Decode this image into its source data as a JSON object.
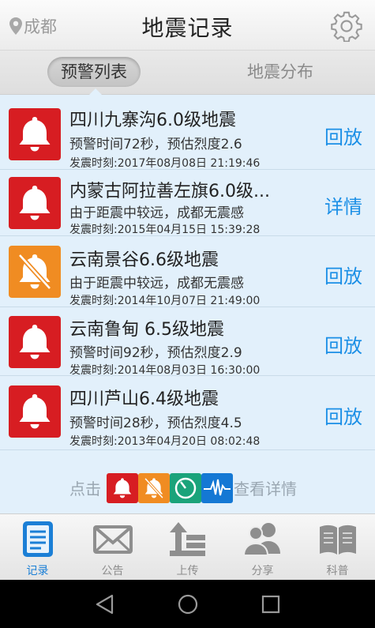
{
  "header": {
    "location": "成都",
    "title": "地震记录"
  },
  "tabs": [
    {
      "label": "预警列表"
    },
    {
      "label": "地震分布"
    }
  ],
  "list": [
    {
      "title": "四川九寨沟6.0级地震",
      "desc": "预警时间72秒，预估烈度2.6",
      "time": "发震时刻:2017年08月08日 21:19:46",
      "action": "回放",
      "level": "red",
      "icon": "bell-icon"
    },
    {
      "title": "内蒙古阿拉善左旗6.0级...",
      "desc": "由于距震中较远，成都无震感",
      "time": "发震时刻:2015年04月15日 15:39:28",
      "action": "详情",
      "level": "red",
      "icon": "bell-icon"
    },
    {
      "title": "云南景谷6.6级地震",
      "desc": "由于距震中较远，成都无震感",
      "time": "发震时刻:2014年10月07日 21:49:00",
      "action": "回放",
      "level": "orange",
      "icon": "bell-muted-icon"
    },
    {
      "title": "云南鲁甸 6.5级地震",
      "desc": "预警时间92秒，预估烈度2.9",
      "time": "发震时刻:2014年08月03日 16:30:00",
      "action": "回放",
      "level": "red",
      "icon": "bell-icon"
    },
    {
      "title": "四川芦山6.4级地震",
      "desc": "预警时间28秒，预估烈度4.5",
      "time": "发震时刻:2013年04月20日 08:02:48",
      "action": "回放",
      "level": "red",
      "icon": "bell-icon"
    }
  ],
  "hint": {
    "prefix": "点击",
    "suffix": "查看详情",
    "icons": [
      "bell-icon",
      "bell-muted-icon",
      "gauge-icon",
      "waveform-icon"
    ]
  },
  "bottom_nav": [
    {
      "label": "记录",
      "icon": "document-icon",
      "active": true
    },
    {
      "label": "公告",
      "icon": "envelope-icon",
      "active": false
    },
    {
      "label": "上传",
      "icon": "upload-icon",
      "active": false
    },
    {
      "label": "分享",
      "icon": "people-icon",
      "active": false
    },
    {
      "label": "科普",
      "icon": "book-icon",
      "active": false
    }
  ],
  "colors": {
    "accent": "#1b8fe6",
    "alert_red": "#d71d22",
    "alert_orange": "#f08c22",
    "list_bg": "#e2f0fb",
    "gauge_green": "#1aa37a",
    "wave_blue": "#1478d4"
  }
}
